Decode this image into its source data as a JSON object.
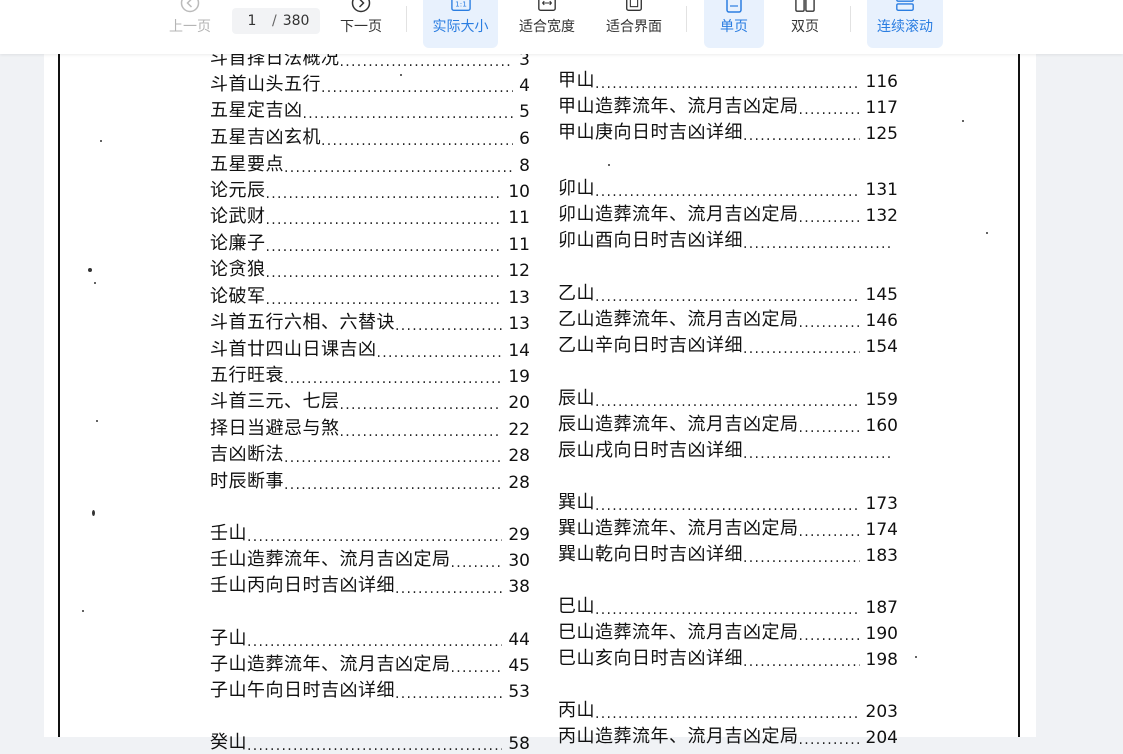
{
  "toolbar": {
    "prev_label": "上一页",
    "page_current": "1",
    "page_separator": "/",
    "page_total": "380",
    "next_label": "下一页",
    "actual_size_label": "实际大小",
    "fit_width_label": "适合宽度",
    "fit_page_label": "适合界面",
    "single_page_label": "单页",
    "double_page_label": "双页",
    "continuous_label": "连续滚动"
  },
  "toc_left": [
    {
      "title": "斗首择日法概况",
      "page": "3"
    },
    {
      "title": "斗首山头五行",
      "page": "4"
    },
    {
      "title": "五星定吉凶",
      "page": "5"
    },
    {
      "title": "五星吉凶玄机",
      "page": "6"
    },
    {
      "title": "五星要点",
      "page": "8"
    },
    {
      "title": "论元辰",
      "page": "10"
    },
    {
      "title": "论武财",
      "page": "11"
    },
    {
      "title": "论廉子",
      "page": "11"
    },
    {
      "title": "论贪狼",
      "page": "12"
    },
    {
      "title": "论破军",
      "page": "13"
    },
    {
      "title": "斗首五行六相、六替诀",
      "page": "13"
    },
    {
      "title": "斗首廿四山日课吉凶",
      "page": "14"
    },
    {
      "title": "五行旺衰",
      "page": "19"
    },
    {
      "title": "斗首三元、七层",
      "page": "20"
    },
    {
      "title": "择日当避忌与煞",
      "page": "22"
    },
    {
      "title": "吉凶断法",
      "page": "28"
    },
    {
      "title": "时辰断事",
      "page": "28"
    },
    {
      "title": "壬山",
      "page": "29"
    },
    {
      "title": "壬山造葬流年、流月吉凶定局",
      "page": "30"
    },
    {
      "title": "壬山丙向日时吉凶详细",
      "page": "38"
    },
    {
      "title": "子山",
      "page": "44"
    },
    {
      "title": "子山造葬流年、流月吉凶定局",
      "page": "45"
    },
    {
      "title": "子山午向日时吉凶详细",
      "page": "53"
    },
    {
      "title": "癸山",
      "page": "58"
    }
  ],
  "toc_right": [
    {
      "title": "甲山",
      "page": "116"
    },
    {
      "title": "甲山造葬流年、流月吉凶定局",
      "page": "117"
    },
    {
      "title": "甲山庚向日时吉凶详细",
      "page": "125"
    },
    {
      "title": "卯山",
      "page": "131"
    },
    {
      "title": "卯山造葬流年、流月吉凶定局",
      "page": "132"
    },
    {
      "title": "卯山酉向日时吉凶详细",
      "page": ""
    },
    {
      "title": "乙山",
      "page": "145"
    },
    {
      "title": "乙山造葬流年、流月吉凶定局",
      "page": "146"
    },
    {
      "title": "乙山辛向日时吉凶详细",
      "page": "154"
    },
    {
      "title": "辰山",
      "page": "159"
    },
    {
      "title": "辰山造葬流年、流月吉凶定局",
      "page": "160"
    },
    {
      "title": "辰山戌向日时吉凶详细",
      "page": ""
    },
    {
      "title": "巽山",
      "page": "173"
    },
    {
      "title": "巽山造葬流年、流月吉凶定局",
      "page": "174"
    },
    {
      "title": "巽山乾向日时吉凶详细",
      "page": "183"
    },
    {
      "title": "巳山",
      "page": "187"
    },
    {
      "title": "巳山造葬流年、流月吉凶定局",
      "page": "190"
    },
    {
      "title": "巳山亥向日时吉凶详细",
      "page": "198"
    },
    {
      "title": "丙山",
      "page": "203"
    },
    {
      "title": "丙山造葬流年、流月吉凶定局",
      "page": "204"
    }
  ],
  "colors": {
    "accent": "#2a7de1",
    "active_bg": "#e8f1fd",
    "toolbar_bg": "#ffffff",
    "page_bg": "#ffffff",
    "outer_bg": "#f0f2f5"
  }
}
